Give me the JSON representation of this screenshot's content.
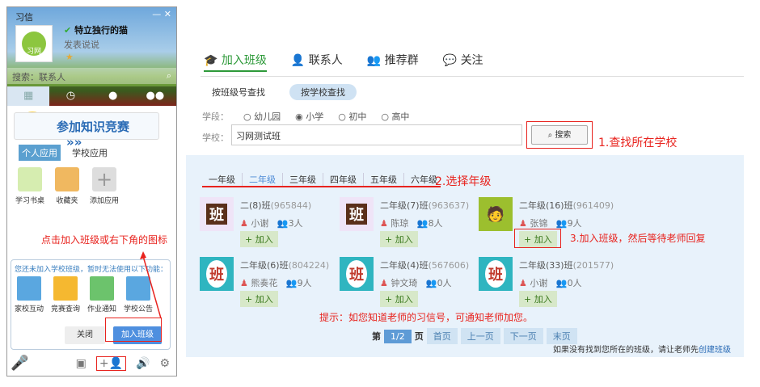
{
  "client": {
    "title": "习信",
    "username": "特立独行的猫",
    "status_text": "发表说说",
    "avatar_text": "习网",
    "search_placeholder": "搜索：联系人",
    "banner": "参加知识竞赛",
    "banner_arrow": "»»",
    "app_tabs": [
      "个人应用",
      "学校应用"
    ],
    "apps": [
      "学习书桌",
      "收藏夹",
      "添加应用"
    ],
    "popup": {
      "message": "您还未加入学校班级，暂时无法使用以下功能：",
      "features": [
        "家校互动",
        "竞赛查询",
        "作业通知",
        "学校公告"
      ],
      "close": "关闭",
      "join": "加入班级"
    },
    "annotation": "点击加入班级或右下角的图标"
  },
  "main": {
    "tabs": [
      "加入班级",
      "联系人",
      "推荐群",
      "关注"
    ],
    "subtabs": [
      "按班级号查找",
      "按学校查找"
    ],
    "level_label": "学段：",
    "levels": [
      "幼儿园",
      "小学",
      "初中",
      "高中"
    ],
    "selected_level": "小学",
    "school_label": "学校：",
    "school_value": "习网测试班",
    "search_button": "搜索",
    "annotation1": "1.查找所在学校",
    "grades": [
      "一年级",
      "二年级",
      "三年级",
      "四年级",
      "五年级",
      "六年级"
    ],
    "selected_grade": "二年级",
    "annotation2": "2.选择年级",
    "classes": [
      {
        "name": "二(8)班",
        "id": "(965844)",
        "teacher": "小谢",
        "count": "3人"
      },
      {
        "name": "二年级(7)班",
        "id": "(963637)",
        "teacher": "陈琼",
        "count": "8人"
      },
      {
        "name": "二年级(16)班",
        "id": "(961409)",
        "teacher": "张锦",
        "count": "9人"
      },
      {
        "name": "二年级(6)班",
        "id": "(804224)",
        "teacher": "熊奏花",
        "count": "9人"
      },
      {
        "name": "二年级(4)班",
        "id": "(567606)",
        "teacher": "钟文琦",
        "count": "0人"
      },
      {
        "name": "二年级(33)班",
        "id": "(201577)",
        "teacher": "小谢",
        "count": "0人"
      }
    ],
    "add_label": "+ 加入",
    "annotation3": "3.加入班级，然后等待老师回复",
    "tip": "提示：如您知道老师的习信号，可通知老师加您。",
    "pager": {
      "prefix": "第",
      "current": "1/2",
      "suffix": "页",
      "first": "首页",
      "prev": "上一页",
      "next": "下一页",
      "last": "末页"
    },
    "footer": "如果没有找到您所在的班级，请让老师先",
    "footer_link": "创建班级"
  }
}
